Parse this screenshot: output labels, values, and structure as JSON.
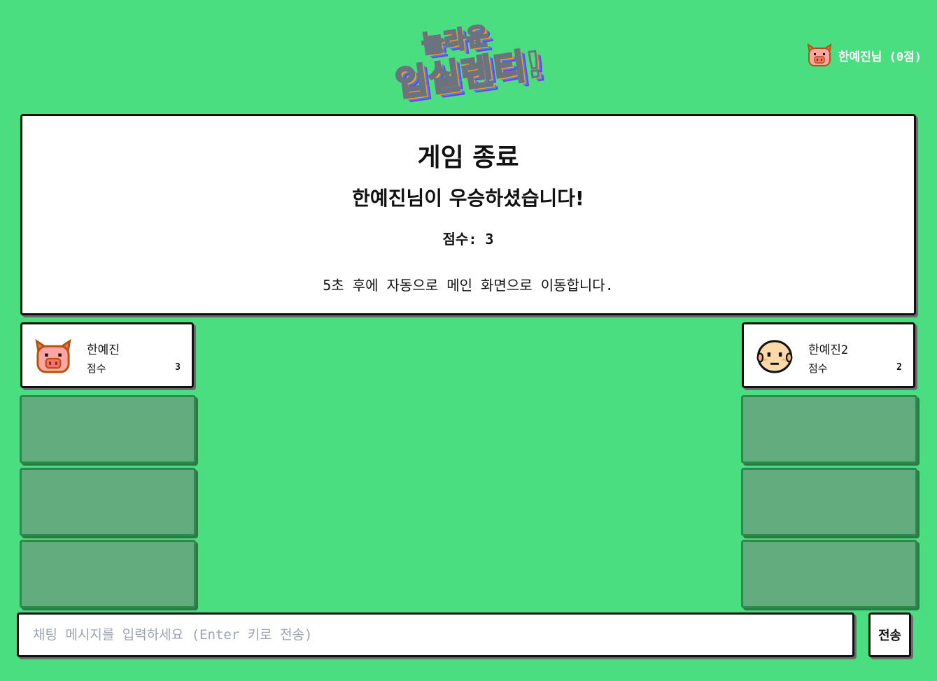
{
  "header": {
    "logo": {
      "line1": "놀라운",
      "line2": "입실렌티!"
    },
    "user": {
      "avatar_icon": "pig-icon",
      "label": "한예진님 (0점)"
    }
  },
  "result": {
    "title": "게임 종료",
    "winner": "한예진님이 우승하셨습니다!",
    "score": "점수: 3",
    "redirect": "5초 후에 자동으로 메인 화면으로 이동합니다."
  },
  "players": {
    "left": {
      "name": "한예진",
      "score_label": "점수",
      "score": "3",
      "avatar_icon": "pig-icon"
    },
    "right": {
      "name": "한예진2",
      "score_label": "점수",
      "score": "2",
      "avatar_icon": "bald-face-icon"
    }
  },
  "chat": {
    "placeholder": "채팅 메시지를 입력하세요 (Enter 키로 전송)",
    "send_label": "전송"
  },
  "colors": {
    "background": "#4ade80",
    "empty_slot": "#63ac7e",
    "empty_slot_border": "#2a8a4c"
  }
}
